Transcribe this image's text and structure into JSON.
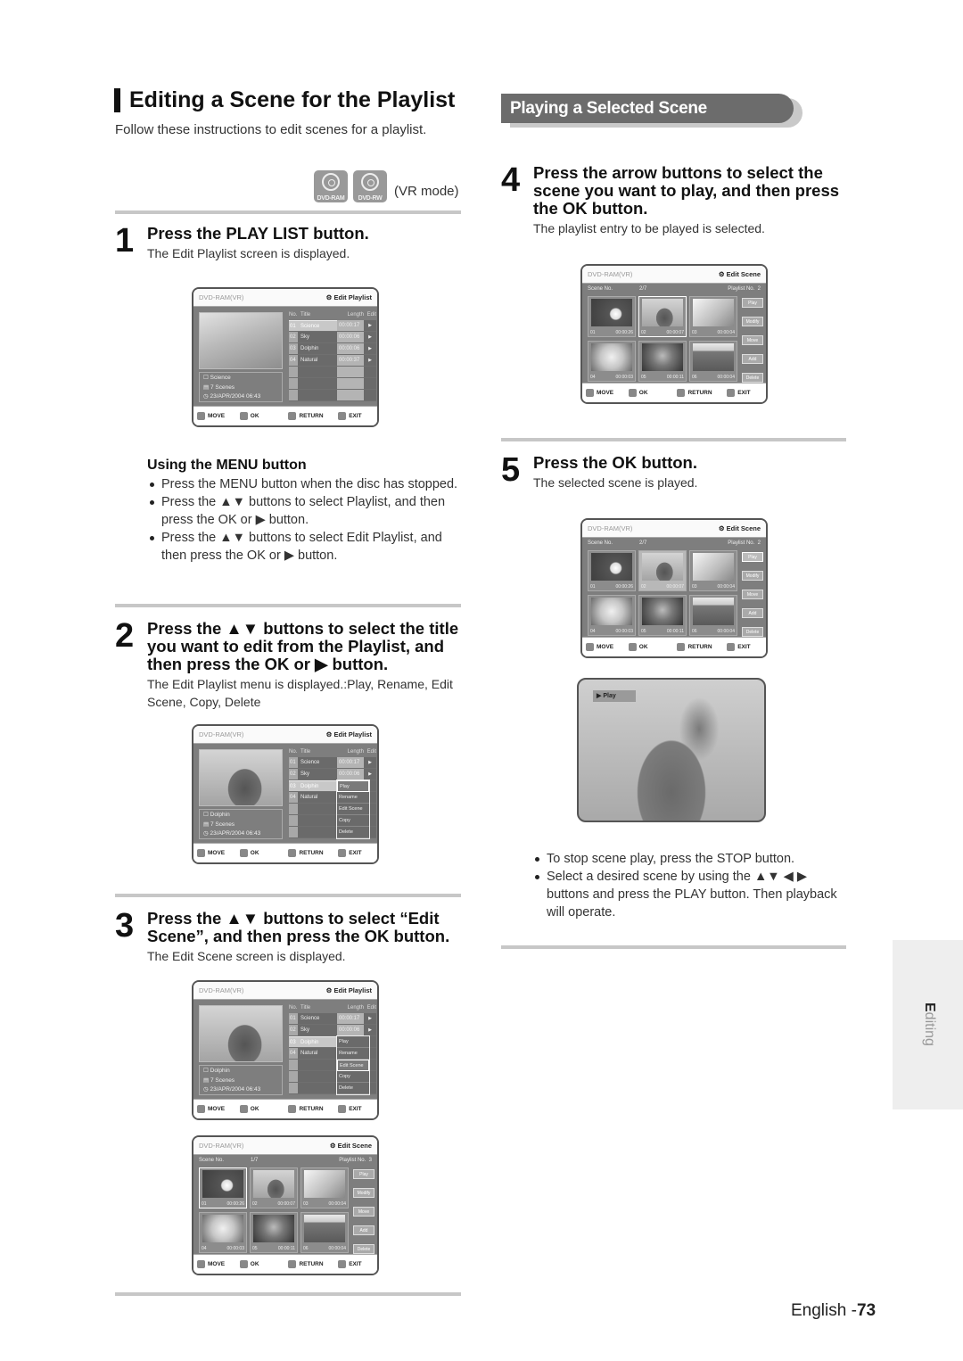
{
  "page": {
    "title": "Editing a Scene for the Playlist",
    "intro": "Follow these instructions to edit scenes for a playlist.",
    "disc_icons": [
      {
        "icon": "dvd-ram-disc-icon",
        "label": "DVD-RAM"
      },
      {
        "icon": "dvd-rw-disc-icon",
        "label": "DVD-RW"
      }
    ],
    "mode_label": "(VR mode)",
    "side_tab": {
      "first_letter": "E",
      "rest": "diting"
    },
    "footer": {
      "language": "English",
      "page_prefix": "-",
      "page_number": "73"
    }
  },
  "steps": {
    "s1": {
      "number": "1",
      "heading": "Press the PLAY LIST button.",
      "desc": "The Edit Playlist screen is displayed."
    },
    "menu_tip": {
      "heading": "Using the MENU button",
      "bullets": [
        "Press the MENU button when the disc has stopped.",
        "Press the ▲▼ buttons to select Playlist, and then press the OK or ▶ button.",
        "Press the ▲▼ buttons to select Edit Playlist, and then press the OK or ▶ button."
      ]
    },
    "s2": {
      "number": "2",
      "heading": "Press the ▲▼ buttons to select the title you want to edit from the Playlist, and then press the OK or ▶ button.",
      "desc": "The Edit Playlist menu is displayed.:Play, Rename, Edit Scene, Copy, Delete"
    },
    "s3": {
      "number": "3",
      "heading": "Press the ▲▼ buttons to select “Edit Scene”, and then press the OK button.",
      "desc": "The Edit Scene screen is displayed."
    },
    "section_title": "Playing a Selected Scene",
    "s4": {
      "number": "4",
      "heading": "Press the arrow buttons to select the scene you want to play, and then press the OK button.",
      "desc": "The playlist entry to be played is selected."
    },
    "s5": {
      "number": "5",
      "heading": "Press the OK button.",
      "desc": "The selected scene is played."
    },
    "notes": [
      "To stop scene play, press the STOP button.",
      "Select a desired scene by using the ▲▼ ◀ ▶ buttons and press the PLAY button. Then playback will operate."
    ]
  },
  "osd": {
    "source": "DVD-RAM(VR)",
    "footer": {
      "move": "MOVE",
      "ok": "OK",
      "return": "RETURN",
      "exit": "EXIT"
    },
    "edit_playlist": {
      "mode": "⚙ Edit Playlist",
      "headers": {
        "no": "No.",
        "title": "Title",
        "length": "Length",
        "edit": "Edit"
      },
      "rows": [
        {
          "no": "01",
          "title": "Science",
          "length": "00:00:17",
          "edit": "▶"
        },
        {
          "no": "02",
          "title": "Sky",
          "length": "00:00:06",
          "edit": "▶"
        },
        {
          "no": "03",
          "title": "Dolphin",
          "length": "00:00:06",
          "edit": "▶"
        },
        {
          "no": "04",
          "title": "Natural",
          "length": "00:00:37",
          "edit": "▶"
        }
      ],
      "popup": [
        "Play",
        "Rename",
        "Edit Scene",
        "Copy",
        "Delete"
      ],
      "screen1_info": {
        "title": "Science",
        "scenes": "7 Scenes",
        "date": "23/APR/2004 06:43"
      },
      "screen2_info": {
        "title": "Dolphin",
        "scenes": "7 Scenes",
        "date": "23/APR/2004 06:43"
      }
    },
    "edit_scene": {
      "mode": "⚙ Edit Scene",
      "scene_label": "Scene No.",
      "playlist_label": "Playlist No.",
      "a": {
        "scene_no": "1/7",
        "playlist_no": "3"
      },
      "b": {
        "scene_no": "2/7",
        "playlist_no": "2"
      },
      "scenes": [
        {
          "no": "01",
          "time": "00:00:26"
        },
        {
          "no": "02",
          "time": "00:00:07"
        },
        {
          "no": "03",
          "time": "00:00:04"
        },
        {
          "no": "04",
          "time": "00:00:03"
        },
        {
          "no": "05",
          "time": "00:00:11"
        },
        {
          "no": "06",
          "time": "00:00:04"
        }
      ],
      "buttons": [
        "Play",
        "Modify",
        "Move",
        "Add",
        "Delete"
      ]
    },
    "play_overlay": "▶ Play"
  }
}
